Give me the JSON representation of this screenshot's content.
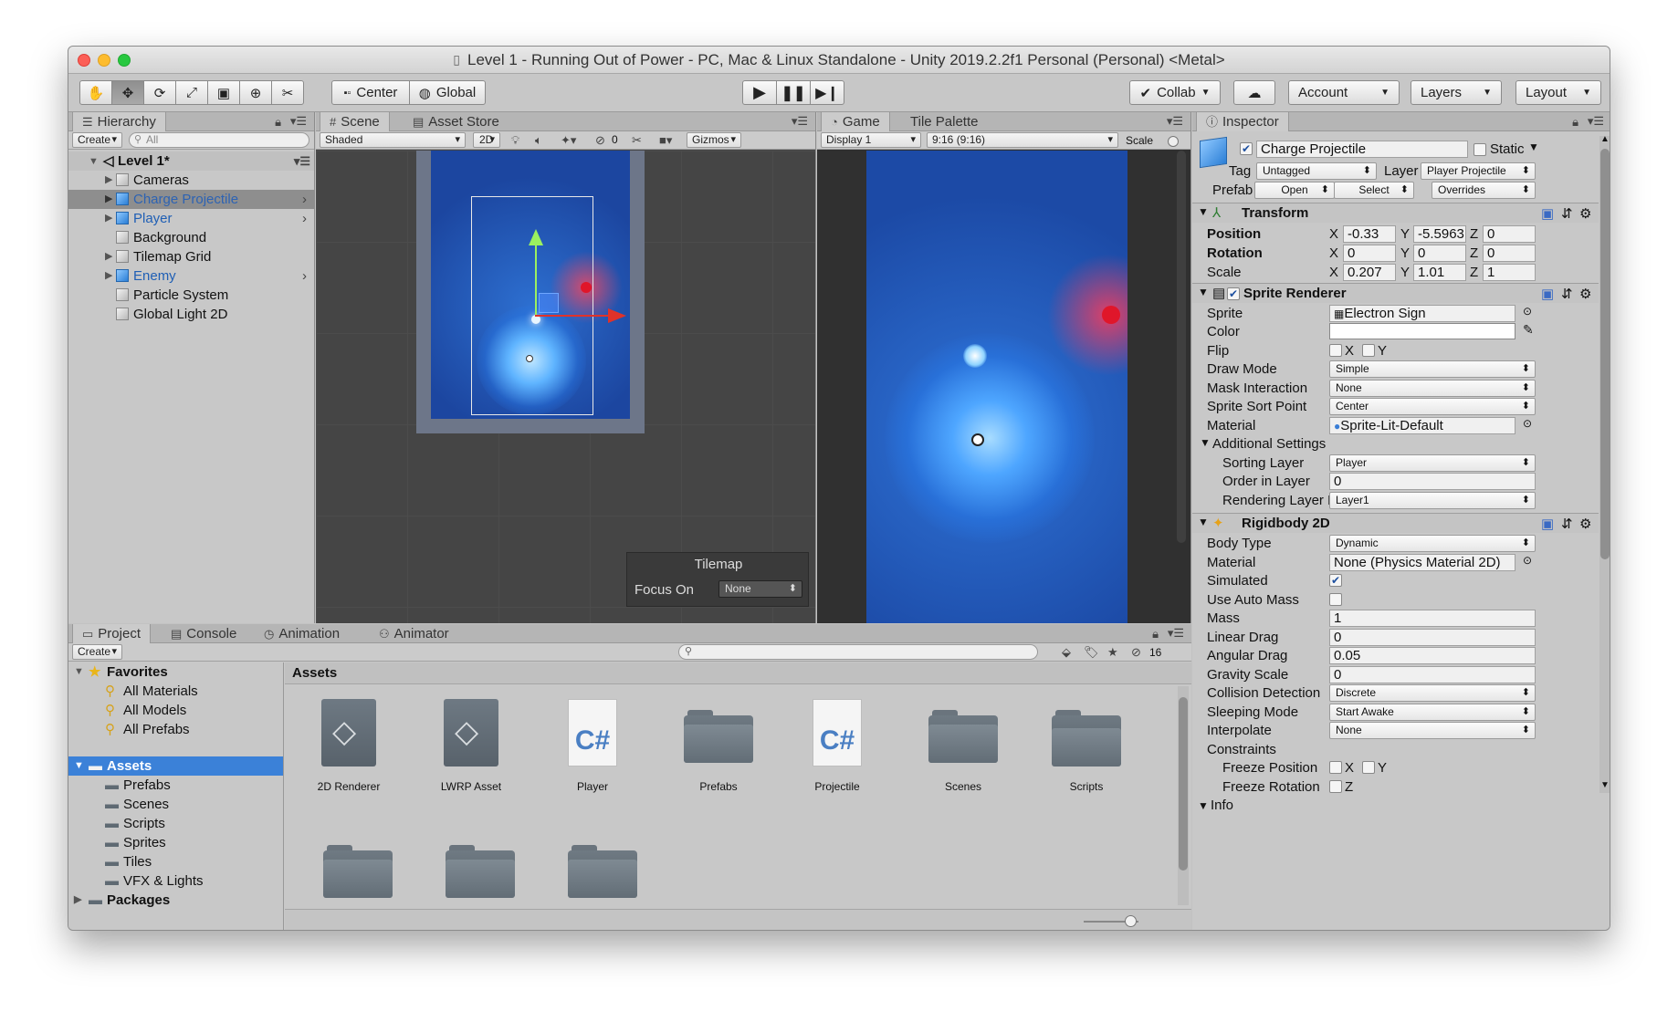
{
  "window": {
    "title": "Level 1 - Running Out of Power - PC, Mac & Linux Standalone - Unity 2019.2.2f1 Personal (Personal) <Metal>"
  },
  "toolbar": {
    "center_label": "Center",
    "global_label": "Global",
    "collab_label": "Collab",
    "account_label": "Account",
    "layers_label": "Layers",
    "layout_label": "Layout"
  },
  "hierarchy": {
    "tab_label": "Hierarchy",
    "create_label": "Create",
    "search_placeholder": "All",
    "scene_name": "Level 1*",
    "items": [
      {
        "label": "Cameras"
      },
      {
        "label": "Charge Projectile"
      },
      {
        "label": "Player"
      },
      {
        "label": "Background"
      },
      {
        "label": "Tilemap Grid"
      },
      {
        "label": "Enemy"
      },
      {
        "label": "Particle System"
      },
      {
        "label": "Global Light 2D"
      }
    ]
  },
  "scene": {
    "tab_label": "Scene",
    "asset_store_label": "Asset Store",
    "shading_label": "Shaded",
    "mode_2d": "2D",
    "hidden_count": "0",
    "gizmos_label": "Gizmos",
    "tilemap_title": "Tilemap",
    "focus_label": "Focus On",
    "focus_value": "None"
  },
  "game": {
    "tab_label": "Game",
    "tile_palette_label": "Tile Palette",
    "display_label": "Display 1",
    "aspect_label": "9:16 (9:16)",
    "scale_label": "Scale"
  },
  "inspector": {
    "tab_label": "Inspector",
    "object_name": "Charge Projectile",
    "static_label": "Static",
    "tag_label": "Tag",
    "tag_value": "Untagged",
    "layer_label": "Layer",
    "layer_value": "Player Projectile",
    "prefab_label": "Prefab",
    "open_label": "Open",
    "select_label": "Select",
    "overrides_label": "Overrides",
    "transform": {
      "title": "Transform",
      "position_label": "Position",
      "pos_x": "-0.33",
      "pos_y": "-5.5963",
      "pos_z": "0",
      "rotation_label": "Rotation",
      "rot_x": "0",
      "rot_y": "0",
      "rot_z": "0",
      "scale_label": "Scale",
      "scale_x": "0.207",
      "scale_y": "1.01",
      "scale_z": "1",
      "x": "X",
      "y": "Y",
      "z": "Z"
    },
    "sprite_renderer": {
      "title": "Sprite Renderer",
      "sprite_label": "Sprite",
      "sprite_value": "Electron Sign",
      "color_label": "Color",
      "flip_label": "Flip",
      "flip_x": "X",
      "flip_y": "Y",
      "draw_mode_label": "Draw Mode",
      "draw_mode_value": "Simple",
      "mask_label": "Mask Interaction",
      "mask_value": "None",
      "sort_point_label": "Sprite Sort Point",
      "sort_point_value": "Center",
      "material_label": "Material",
      "material_value": "Sprite-Lit-Default",
      "additional_label": "Additional Settings",
      "sorting_layer_label": "Sorting Layer",
      "sorting_layer_value": "Player",
      "order_label": "Order in Layer",
      "order_value": "0",
      "rendering_label": "Rendering Layer Ma",
      "rendering_value": "Layer1"
    },
    "rigidbody": {
      "title": "Rigidbody 2D",
      "body_type_label": "Body Type",
      "body_type_value": "Dynamic",
      "material_label": "Material",
      "material_value": "None (Physics Material 2D)",
      "simulated_label": "Simulated",
      "auto_mass_label": "Use Auto Mass",
      "mass_label": "Mass",
      "mass_value": "1",
      "linear_drag_label": "Linear Drag",
      "linear_drag_value": "0",
      "angular_drag_label": "Angular Drag",
      "angular_drag_value": "0.05",
      "gravity_label": "Gravity Scale",
      "gravity_value": "0",
      "collision_label": "Collision Detection",
      "collision_value": "Discrete",
      "sleeping_label": "Sleeping Mode",
      "sleeping_value": "Start Awake",
      "interpolate_label": "Interpolate",
      "interpolate_value": "None",
      "constraints_label": "Constraints",
      "freeze_pos_label": "Freeze Position",
      "freeze_rot_label": "Freeze Rotation",
      "x": "X",
      "y": "Y",
      "z": "Z",
      "info_label": "Info"
    }
  },
  "project": {
    "tabs": [
      {
        "label": "Project"
      },
      {
        "label": "Console"
      },
      {
        "label": "Animation"
      },
      {
        "label": "Animator"
      }
    ],
    "create_label": "Create",
    "badge_count": "16",
    "favorites_label": "Favorites",
    "favorites": [
      {
        "label": "All Materials"
      },
      {
        "label": "All Models"
      },
      {
        "label": "All Prefabs"
      }
    ],
    "assets_label": "Assets",
    "asset_folders": [
      {
        "label": "Prefabs"
      },
      {
        "label": "Scenes"
      },
      {
        "label": "Scripts"
      },
      {
        "label": "Sprites"
      },
      {
        "label": "Tiles"
      },
      {
        "label": "VFX & Lights"
      }
    ],
    "packages_label": "Packages",
    "breadcrumb": "Assets",
    "grid_items": [
      {
        "label": "2D Renderer"
      },
      {
        "label": "LWRP Asset"
      },
      {
        "label": "Player"
      },
      {
        "label": "Prefabs"
      },
      {
        "label": "Projectile"
      },
      {
        "label": "Scenes"
      },
      {
        "label": "Scripts"
      }
    ],
    "cs_glyph": "C#"
  },
  "colors": {
    "selection": "#3b81d8",
    "scene_bg": "#1f4fa7",
    "enemy_red": "#e0162a"
  }
}
